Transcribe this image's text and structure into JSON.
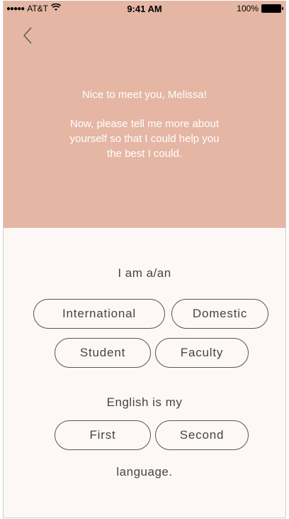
{
  "status_bar": {
    "signal_dots": "●●●●●",
    "carrier": "AT&T",
    "time": "9:41 AM",
    "battery": "100%",
    "wifi_icon": "wifi-icon",
    "battery_icon": "battery-icon"
  },
  "header": {
    "back_icon": "chevron-left-icon",
    "greeting_line": "Nice to meet you, Melissa!",
    "message_line1": "Now, please tell me more about",
    "message_line2": "yourself so that I could help you",
    "message_line3": "the best I could."
  },
  "form": {
    "identity_prompt": "I am a/an",
    "identity_options": [
      "International",
      "Domestic",
      "Student",
      "Faculty"
    ],
    "language_prompt": "English is my",
    "language_options": [
      "First",
      "Second"
    ],
    "language_suffix": "language."
  },
  "colors": {
    "header_bg": "#e5b6a4",
    "body_bg": "#fdf8f6",
    "pill_border": "#555555"
  }
}
